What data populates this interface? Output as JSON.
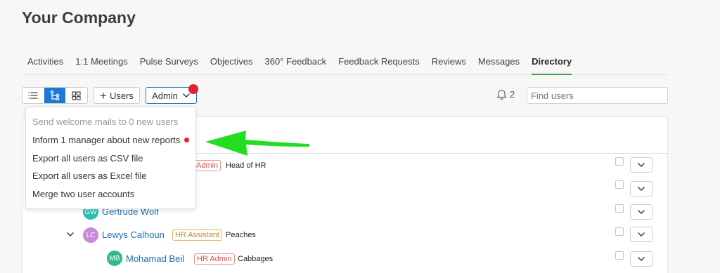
{
  "company": {
    "title": "Your Company"
  },
  "tabs": [
    {
      "label": "Activities",
      "active": false
    },
    {
      "label": "1:1 Meetings",
      "active": false
    },
    {
      "label": "Pulse Surveys",
      "active": false
    },
    {
      "label": "Objectives",
      "active": false
    },
    {
      "label": "360° Feedback",
      "active": false
    },
    {
      "label": "Feedback Requests",
      "active": false
    },
    {
      "label": "Reviews",
      "active": false
    },
    {
      "label": "Messages",
      "active": false
    },
    {
      "label": "Directory",
      "active": true
    }
  ],
  "toolbar": {
    "view_modes": [
      "list-icon",
      "tree-icon",
      "grid-icon"
    ],
    "active_view": "tree-icon",
    "add_users_label": "Users",
    "admin_label": "Admin",
    "notification_count": "2",
    "search_placeholder": "Find users"
  },
  "admin_menu": {
    "items": [
      {
        "label": "Send welcome mails to 0 new users",
        "disabled": true
      },
      {
        "label": "Inform 1 manager about new reports",
        "disabled": false,
        "has_dot": true
      },
      {
        "label": "Export all users as CSV file",
        "disabled": false
      },
      {
        "label": "Export all users as Excel file",
        "disabled": false
      },
      {
        "label": "Merge two user accounts",
        "disabled": false
      }
    ]
  },
  "users": [
    {
      "initials": "",
      "name": "",
      "role": "Admin",
      "role_color": "red",
      "job": "Head of HR"
    },
    {
      "initials": "",
      "name": "",
      "role": "",
      "job": ""
    },
    {
      "initials": "GW",
      "name": "Gertrude Wolf",
      "avatar_color": "#2bbfb0",
      "role": "",
      "job": ""
    },
    {
      "initials": "LC",
      "name": "Lewys Calhoun",
      "avatar_color": "#c889d8",
      "role": "HR Assistant",
      "role_color": "orange",
      "job": "Peaches"
    },
    {
      "initials": "MB",
      "name": "Mohamad Beil",
      "avatar_color": "#2dbb8a",
      "role": "HR Admin",
      "role_color": "red",
      "job": "Cabbages"
    }
  ],
  "colors": {
    "accent": "#1a7bd6",
    "active_tab_underline": "#3ea33e",
    "alert_dot": "#e8202e",
    "arrow": "#22dd22"
  }
}
